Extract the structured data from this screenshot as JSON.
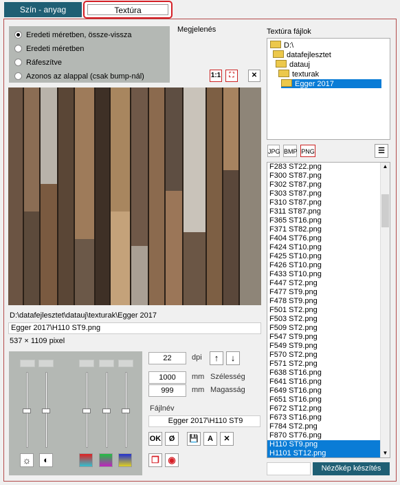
{
  "tabs": {
    "color_material": "Szín - anyag",
    "texture": "Textúra"
  },
  "display_title": "Megjelenés",
  "radios": [
    {
      "label": "Eredeti méretben, össze-vissza",
      "selected": true
    },
    {
      "label": "Eredeti méretben",
      "selected": false
    },
    {
      "label": "Ráfeszítve",
      "selected": false
    },
    {
      "label": "Azonos az alappal (csak bump-nál)",
      "selected": false
    }
  ],
  "view_buttons": {
    "one_to_one": "1:1",
    "fit": "⛶",
    "clear": "✕"
  },
  "path": "D:\\datafejlesztet\\datauj\\texturak\\Egger 2017",
  "file_name_field": "Egger 2017\\H110 ST9.png",
  "pixel_size": "537 × 1109 pixel",
  "dpi": {
    "value": "22",
    "unit": "dpi"
  },
  "width": {
    "value": "1000",
    "unit": "mm",
    "label": "Szélesség"
  },
  "height": {
    "value": "999",
    "unit": "mm",
    "label": "Magasság"
  },
  "filename_label": "Fájlnév",
  "filename_value": "Egger 2017\\H110 ST9",
  "action_buttons": {
    "ok": "OK",
    "cancel": "Ø",
    "save": "💾",
    "rename": "A",
    "delete": "✕"
  },
  "tree_title": "Textúra fájlok",
  "tree": [
    {
      "label": "D:\\",
      "indent": 0,
      "selected": false
    },
    {
      "label": "datafejlesztet",
      "indent": 1,
      "selected": false
    },
    {
      "label": "datauj",
      "indent": 2,
      "selected": false
    },
    {
      "label": "texturak",
      "indent": 3,
      "selected": false
    },
    {
      "label": "Egger 2017",
      "indent": 4,
      "selected": true
    }
  ],
  "formats": [
    "JPG",
    "BMP",
    "PNG"
  ],
  "files": [
    "F283 ST22.png",
    "F300 ST87.png",
    "F302 ST87.png",
    "F303 ST87.png",
    "F310 ST87.png",
    "F311 ST87.png",
    "F365 ST16.png",
    "F371 ST82.png",
    "F404 ST76.png",
    "F424 ST10.png",
    "F425 ST10.png",
    "F426 ST10.png",
    "F433 ST10.png",
    "F447 ST2.png",
    "F477 ST9.png",
    "F478 ST9.png",
    "F501 ST2.png",
    "F503 ST2.png",
    "F509 ST2.png",
    "F547 ST9.png",
    "F549 ST9.png",
    "F570 ST2.png",
    "F571 ST2.png",
    "F638 ST16.png",
    "F641 ST16.png",
    "F649 ST16.png",
    "F651 ST16.png",
    "F672 ST12.png",
    "F673 ST16.png",
    "F784 ST2.png",
    "F870 ST76.png",
    "H110 ST9.png",
    "H1101 ST12.png"
  ],
  "selected_files": [
    "H110 ST9.png",
    "H1101 ST12.png"
  ],
  "preview_button": "Nézőkép készítés",
  "colors": {
    "accent": "#1f5f74",
    "selection": "#0a7cd6",
    "highlight_border": "#d51f26"
  }
}
